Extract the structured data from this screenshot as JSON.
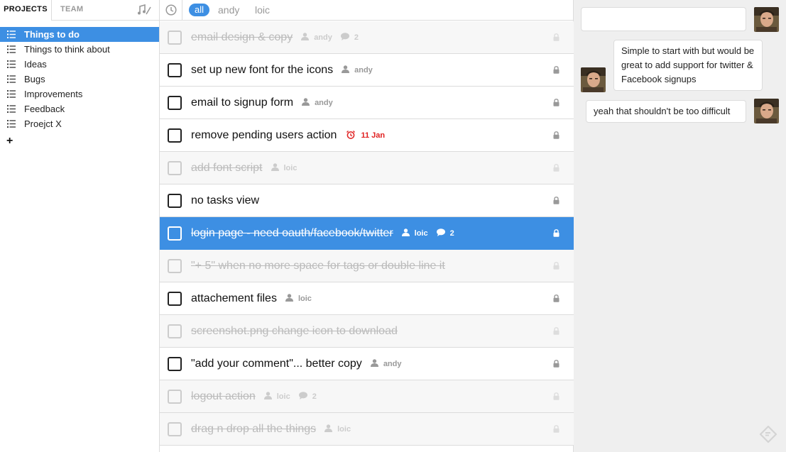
{
  "sidebar": {
    "tabs": {
      "projects": "PROJECTS",
      "team": "TEAM"
    },
    "projects": [
      {
        "label": "Things to do",
        "active": true
      },
      {
        "label": "Things to think about",
        "active": false
      },
      {
        "label": "Ideas",
        "active": false
      },
      {
        "label": "Bugs",
        "active": false
      },
      {
        "label": "Improvements",
        "active": false
      },
      {
        "label": "Feedback",
        "active": false
      },
      {
        "label": "Proejct X",
        "active": false
      }
    ],
    "add_label": "+"
  },
  "filters": {
    "all": "all",
    "andy": "andy",
    "loic": "loic"
  },
  "tasks": [
    {
      "title": "email design & copy",
      "done": true,
      "assignee": "andy",
      "comments": "2"
    },
    {
      "title": "set up new font for the icons",
      "done": false,
      "assignee": "andy"
    },
    {
      "title": "email to signup form",
      "done": false,
      "assignee": "andy"
    },
    {
      "title": "remove pending users action",
      "done": false,
      "due": "11 Jan"
    },
    {
      "title": "add font script",
      "done": true,
      "assignee": "loic"
    },
    {
      "title": "no tasks view",
      "done": false
    },
    {
      "title": "login page - need oauth/facebook/twitter",
      "done": true,
      "selected": true,
      "assignee": "loic",
      "comments": "2"
    },
    {
      "title": "\"+ 5\" when no more space for tags or double line it",
      "done": true
    },
    {
      "title": "attachement files",
      "done": false,
      "assignee": "loic"
    },
    {
      "title": "screenshot.png change icon to download",
      "done": true
    },
    {
      "title": "\"add your comment\"... better copy",
      "done": false,
      "assignee": "andy"
    },
    {
      "title": "logout action",
      "done": true,
      "assignee": "loic",
      "comments": "2"
    },
    {
      "title": "drag n drop all the things",
      "done": true,
      "assignee": "loic"
    }
  ],
  "comments_panel": {
    "input_value": "",
    "messages": [
      {
        "text": "Simple to start with but would be great to add support for twitter & Facebook signups",
        "side": "left"
      },
      {
        "text": "yeah that shouldn't be too difficult",
        "side": "right"
      }
    ]
  },
  "colors": {
    "accent": "#3d8fe3",
    "due_date": "#e02020",
    "done_text": "#bbbbbb",
    "panel_bg": "#efefef"
  },
  "icons": {
    "list": "list-icon",
    "clock": "clock-icon",
    "person": "person-icon",
    "comment": "comment-bubble-icon",
    "lock": "lock-icon",
    "alarm": "alarm-clock-icon",
    "music": "music-notes-icon",
    "feedback": "feedback-icon"
  }
}
